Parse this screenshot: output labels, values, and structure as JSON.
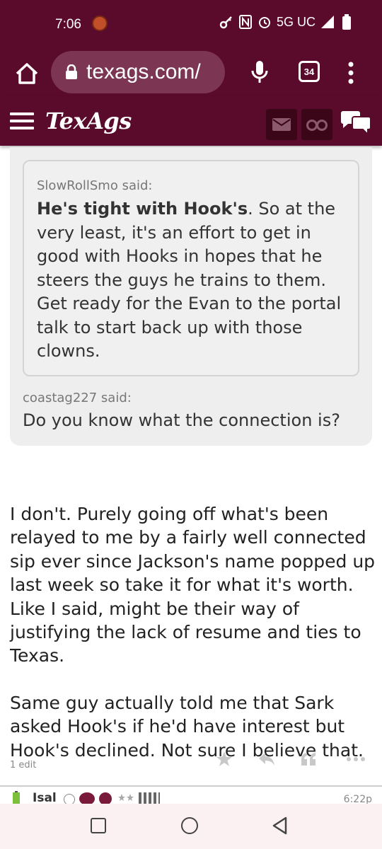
{
  "status_bar": {
    "time": "7:06",
    "network": "5G UC"
  },
  "browser": {
    "url": "texags.com/",
    "tab_count": "34"
  },
  "site": {
    "logo": "TexAgs"
  },
  "quote": {
    "inner_author": "SlowRollSmo said:",
    "inner_bold": "He's tight with Hook's",
    "inner_text": ". So at the very least, it's an effort to get in good with Hooks in hopes that he steers the guys he trains to them. Get ready for the Evan to the portal talk to start back up with those clowns.",
    "outer_author": "coastag227 said:",
    "outer_text": "Do you know what the connection is?"
  },
  "post": {
    "paragraphs": [
      "I don't. Purely going off what's been relayed to me by a fairly well connected sip ever since Jackson's name popped up last week so take it for what it's worth. Like I said, might be their way of justifying the lack of resume and ties to Texas.",
      "Same guy actually told me that Sark asked Hook's if he'd have interest but Hook's declined. Not sure I believe that."
    ],
    "edit_count": "1 edit"
  },
  "next_post": {
    "username": "Isal",
    "time": "6:22p"
  },
  "colors": {
    "brand_maroon": "#5a0a2a",
    "quote_bg": "#eeeeee"
  }
}
